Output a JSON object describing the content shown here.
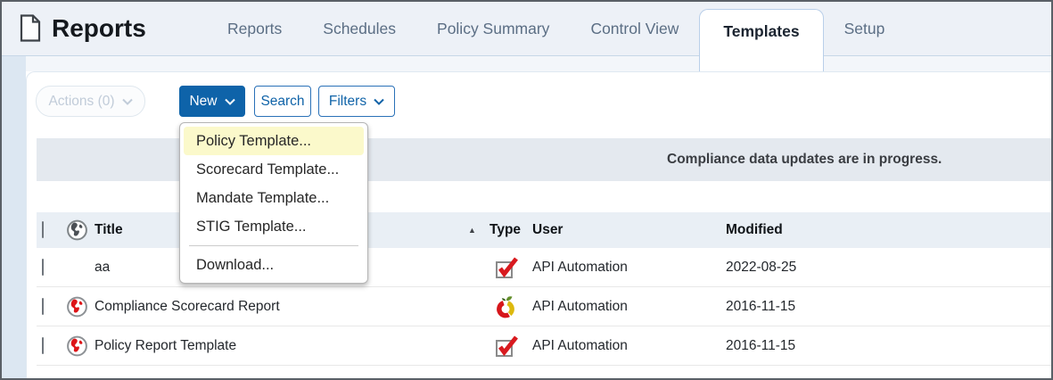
{
  "window": {
    "title": "Reports"
  },
  "tabs": [
    {
      "label": "Reports"
    },
    {
      "label": "Schedules"
    },
    {
      "label": "Policy Summary"
    },
    {
      "label": "Control View"
    },
    {
      "label": "Templates",
      "active": true
    },
    {
      "label": "Setup"
    }
  ],
  "toolbar": {
    "actions_label": "Actions (0)",
    "new_label": "New",
    "search_label": "Search",
    "filters_label": "Filters"
  },
  "new_menu": {
    "items": [
      {
        "label": "Policy Template...",
        "highlighted": true
      },
      {
        "label": "Scorecard Template..."
      },
      {
        "label": "Mandate Template..."
      },
      {
        "label": "STIG Template..."
      },
      {
        "label": "Download...",
        "divider_above": true
      }
    ]
  },
  "notification": {
    "message": "Compliance data updates are in progress."
  },
  "table": {
    "columns": {
      "title": "Title",
      "type": "Type",
      "user": "User",
      "modified": "Modified"
    },
    "sort": {
      "column": "Type",
      "direction": "ascending",
      "glyph": "▲"
    },
    "rows": [
      {
        "title": "aa",
        "global": false,
        "type": "policy-template",
        "user": "API Automation",
        "modified": "2022-08-25"
      },
      {
        "title": "Compliance Scorecard Report",
        "global": true,
        "type": "scorecard-template",
        "user": "API Automation",
        "modified": "2016-11-15"
      },
      {
        "title": "Policy Report Template",
        "global": true,
        "type": "policy-template",
        "user": "API Automation",
        "modified": "2016-11-15"
      }
    ]
  },
  "colors": {
    "accent_blue": "#0e63a9",
    "menu_highlight": "#fbf9cb",
    "alert_red": "#d8161c",
    "scorecard_yellow": "#ddb90e",
    "header_bg": "#edf1f7",
    "notice_bg": "#e4e9ef"
  }
}
